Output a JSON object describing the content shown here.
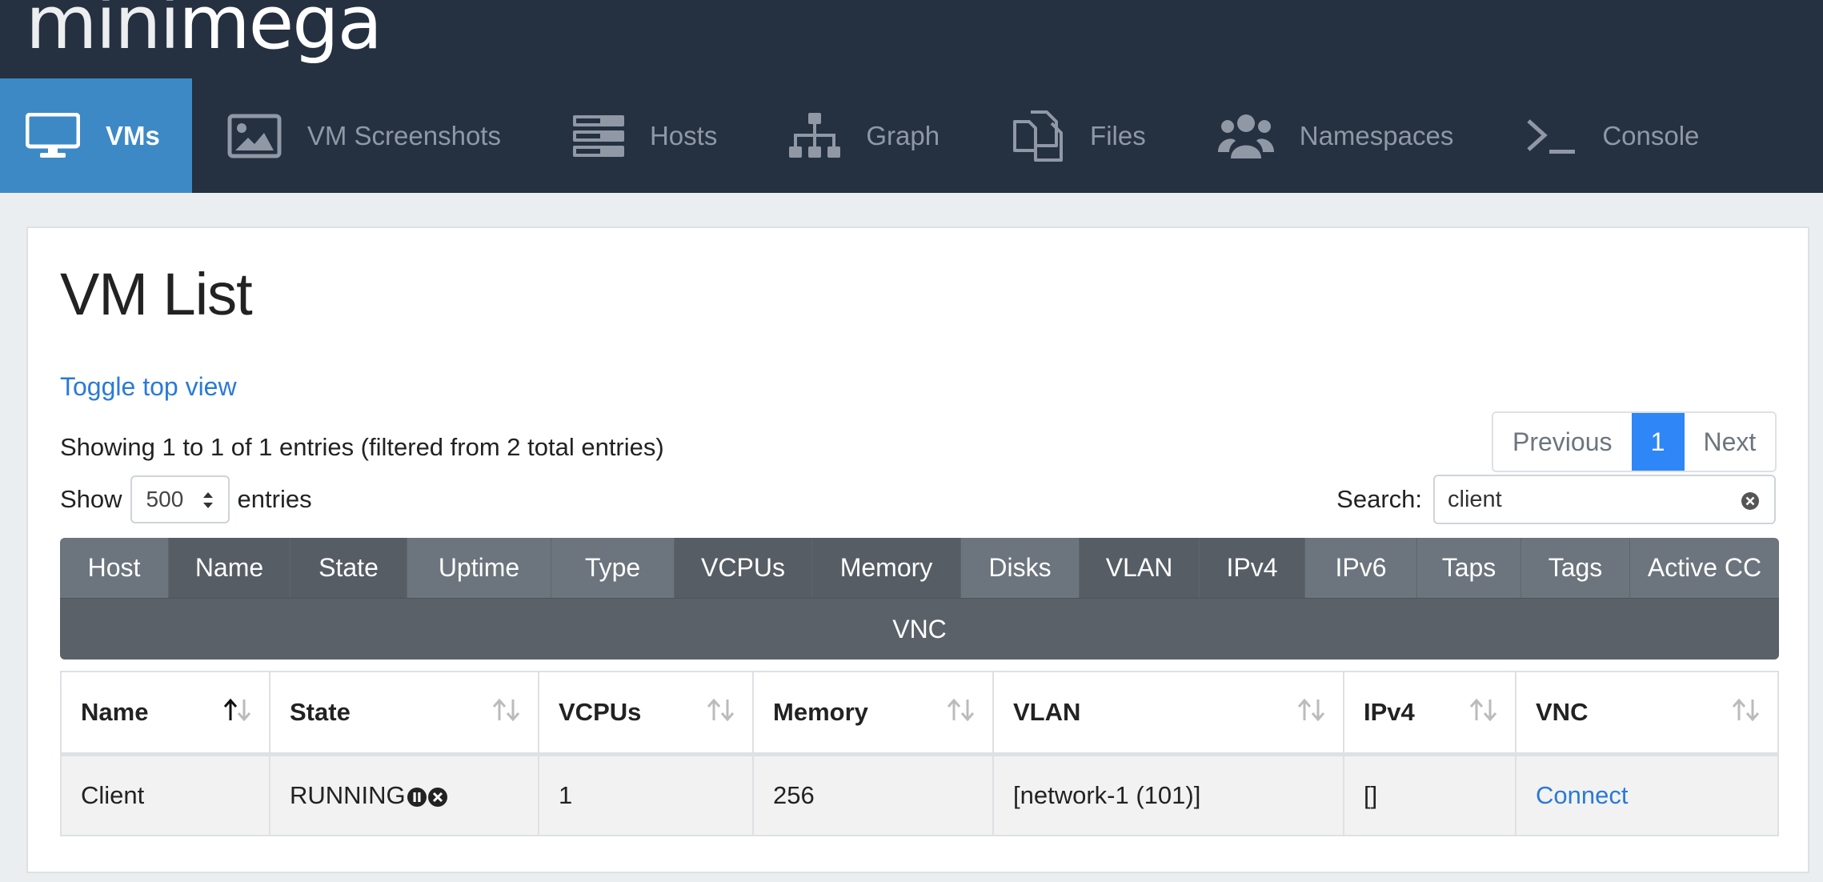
{
  "brand": {
    "light": "mini",
    "bold": "mega"
  },
  "nav": [
    {
      "label": "VMs",
      "icon": "monitor-icon",
      "active": true
    },
    {
      "label": "VM Screenshots",
      "icon": "image-icon"
    },
    {
      "label": "Hosts",
      "icon": "server-icon"
    },
    {
      "label": "Graph",
      "icon": "sitemap-icon"
    },
    {
      "label": "Files",
      "icon": "files-icon"
    },
    {
      "label": "Namespaces",
      "icon": "users-icon"
    },
    {
      "label": "Console",
      "icon": "terminal-icon"
    }
  ],
  "page": {
    "title": "VM List",
    "toggle_link": "Toggle top view",
    "info": "Showing 1 to 1 of 1 entries (filtered from 2 total entries)",
    "show_label": "Show",
    "entries_label": "entries",
    "length_value": "500",
    "search_label": "Search:",
    "search_value": "client"
  },
  "pager": {
    "previous": "Previous",
    "current": "1",
    "next": "Next"
  },
  "column_toggles": [
    {
      "label": "Host"
    },
    {
      "label": "Name"
    },
    {
      "label": "State"
    },
    {
      "label": "Uptime"
    },
    {
      "label": "Type"
    },
    {
      "label": "VCPUs"
    },
    {
      "label": "Memory"
    },
    {
      "label": "Disks"
    },
    {
      "label": "VLAN"
    },
    {
      "label": "IPv4"
    },
    {
      "label": "IPv6"
    },
    {
      "label": "Taps"
    },
    {
      "label": "Tags"
    },
    {
      "label": "Active CC"
    }
  ],
  "vnc_toggle": "VNC",
  "table": {
    "headers": [
      "Name",
      "State",
      "VCPUs",
      "Memory",
      "VLAN",
      "IPv4",
      "VNC"
    ],
    "rows": [
      {
        "name": "Client",
        "state": "RUNNING",
        "vcpus": "1",
        "memory": "256",
        "vlan": "[network-1 (101)]",
        "ipv4": "[]",
        "vnc": "Connect"
      }
    ]
  },
  "colors": {
    "header_bg": "#253041",
    "accent": "#3d89c6",
    "link": "#2a7ad6",
    "page_btn": "#2f86f6"
  }
}
